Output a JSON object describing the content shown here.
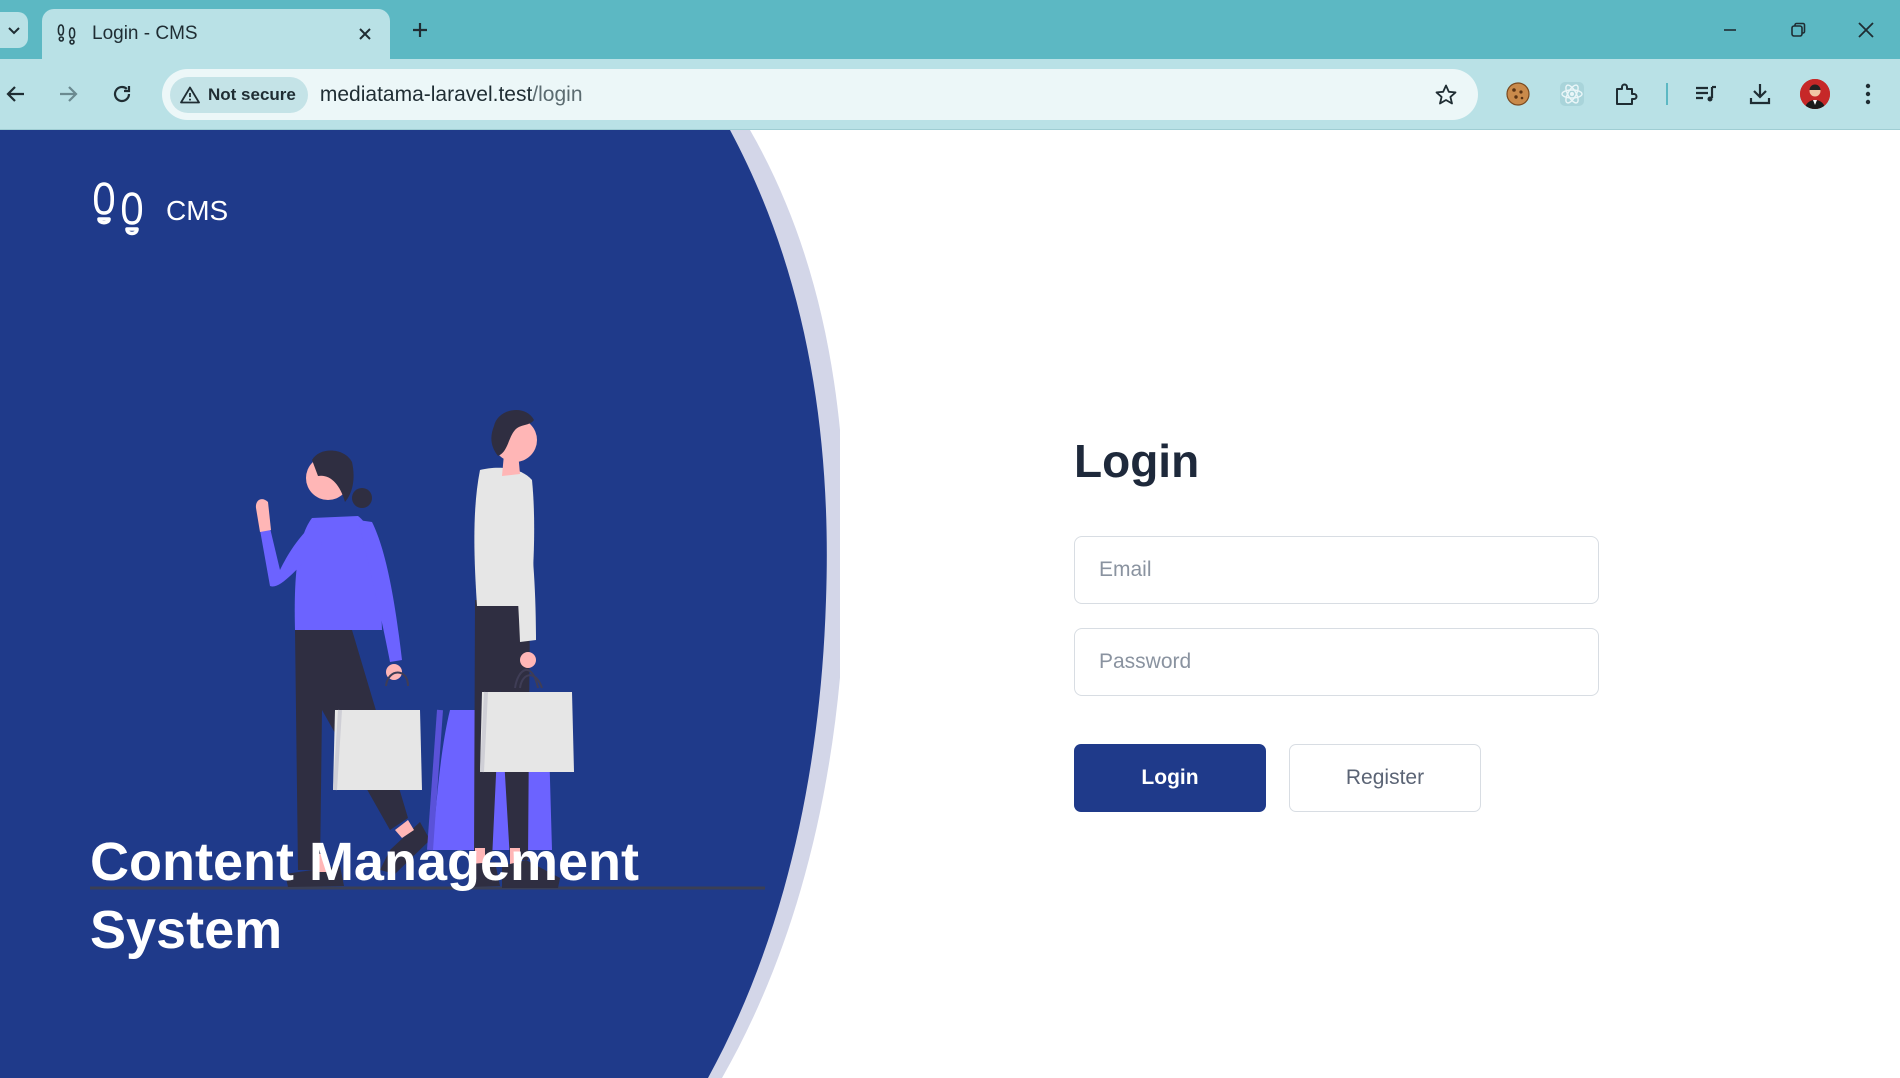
{
  "browser": {
    "tab_title": "Login - CMS",
    "security_label": "Not secure",
    "url_host": "mediatama-laravel.test",
    "url_path": "/login"
  },
  "icons": {
    "tab_list": "chevron-down-icon",
    "favicon": "footprints-icon",
    "close_tab": "close-icon",
    "new_tab": "plus-icon",
    "back": "arrow-left-icon",
    "forward": "arrow-right-icon",
    "reload": "reload-icon",
    "warning": "warning-triangle-icon",
    "bookmark": "star-icon",
    "extensions": [
      "cookie-icon",
      "react-icon",
      "puzzle-icon"
    ],
    "media": "media-queue-icon",
    "downloads": "download-icon",
    "menu": "more-vertical-icon"
  },
  "brand": {
    "name": "CMS"
  },
  "hero": {
    "title": "Content Management System"
  },
  "login_form": {
    "heading": "Login",
    "email_placeholder": "Email",
    "password_placeholder": "Password",
    "login_label": "Login",
    "register_label": "Register"
  },
  "colors": {
    "tabstrip": "#5cb8c3",
    "toolbar": "#b9e1e6",
    "hero_blue": "#1f3a8a",
    "primary_button": "#1f3a8a",
    "heading_text": "#1e293b",
    "accent_purple": "#6c63ff"
  }
}
